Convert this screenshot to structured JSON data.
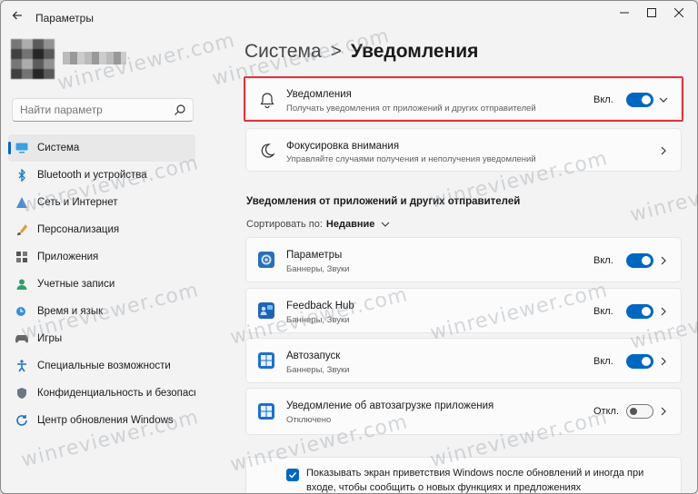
{
  "window": {
    "title": "Параметры",
    "back_icon": "arrow-left-icon",
    "minimize_icon": "minimize-icon",
    "maximize_icon": "maximize-icon",
    "close_icon": "close-icon"
  },
  "search": {
    "placeholder": "Найти параметр",
    "icon": "search-icon"
  },
  "sidebar": {
    "items": [
      {
        "label": "Система",
        "icon": "system-icon",
        "active": true
      },
      {
        "label": "Bluetooth и устройства",
        "icon": "bluetooth-icon"
      },
      {
        "label": "Сеть и Интернет",
        "icon": "network-icon"
      },
      {
        "label": "Персонализация",
        "icon": "personalization-icon"
      },
      {
        "label": "Приложения",
        "icon": "apps-icon"
      },
      {
        "label": "Учетные записи",
        "icon": "accounts-icon"
      },
      {
        "label": "Время и язык",
        "icon": "time-language-icon"
      },
      {
        "label": "Игры",
        "icon": "gaming-icon"
      },
      {
        "label": "Специальные возможности",
        "icon": "accessibility-icon"
      },
      {
        "label": "Конфиденциальность и безопасность",
        "icon": "privacy-shield-icon"
      },
      {
        "label": "Центр обновления Windows",
        "icon": "windows-update-icon"
      }
    ]
  },
  "breadcrumb": {
    "parent": "Система",
    "separator": ">",
    "current": "Уведомления"
  },
  "notifications_card": {
    "title": "Уведомления",
    "subtitle": "Получать уведомления от приложений и других отправителей",
    "state": "Вкл.",
    "on": true
  },
  "focus_card": {
    "title": "Фокусировка внимания",
    "subtitle": "Управляйте случаями получения и неполучения уведомлений"
  },
  "section": {
    "title": "Уведомления от приложений и других отправителей",
    "sort_label": "Сортировать по:",
    "sort_value": "Недавние"
  },
  "apps": [
    {
      "name": "Параметры",
      "sub": "Баннеры, Звуки",
      "state": "Вкл.",
      "on": true,
      "icon": "settings-gear-app-icon"
    },
    {
      "name": "Feedback Hub",
      "sub": "Баннеры, Звуки",
      "state": "Вкл.",
      "on": true,
      "icon": "feedback-hub-app-icon"
    },
    {
      "name": "Автозапуск",
      "sub": "Баннеры, Звуки",
      "state": "Вкл.",
      "on": true,
      "icon": "autoplay-app-icon"
    },
    {
      "name": "Уведомление об автозагрузке приложения",
      "sub": "Отключено",
      "state": "Откл.",
      "on": false,
      "icon": "startup-app-icon"
    }
  ],
  "bottom": {
    "checked": true,
    "text": "Показывать экран приветствия Windows после обновлений и иногда при входе, чтобы сообщить о новых функциях и предложениях"
  },
  "watermark": "winreviewer.com",
  "colors": {
    "accent": "#0067c0",
    "highlight": "#e0333a",
    "background": "#f3f3f3",
    "card": "#fbfbfb"
  }
}
